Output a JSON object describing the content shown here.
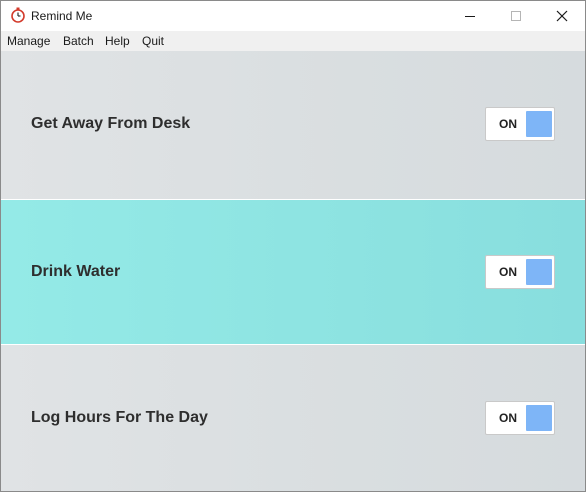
{
  "window": {
    "title": "Remind Me",
    "app_icon": "stopwatch-icon"
  },
  "menu": {
    "items": [
      "Manage",
      "Batch",
      "Help",
      "Quit"
    ]
  },
  "reminders": [
    {
      "title": "Get Away From Desk",
      "toggle_label": "ON",
      "enabled": true,
      "highlighted": false
    },
    {
      "title": "Drink Water",
      "toggle_label": "ON",
      "enabled": true,
      "highlighted": true
    },
    {
      "title": "Log Hours For The Day",
      "toggle_label": "ON",
      "enabled": true,
      "highlighted": false
    }
  ],
  "colors": {
    "highlight_panel": "#8de3e1",
    "panel_background": "#dadfe1",
    "toggle_knob": "#7eb5f7"
  }
}
